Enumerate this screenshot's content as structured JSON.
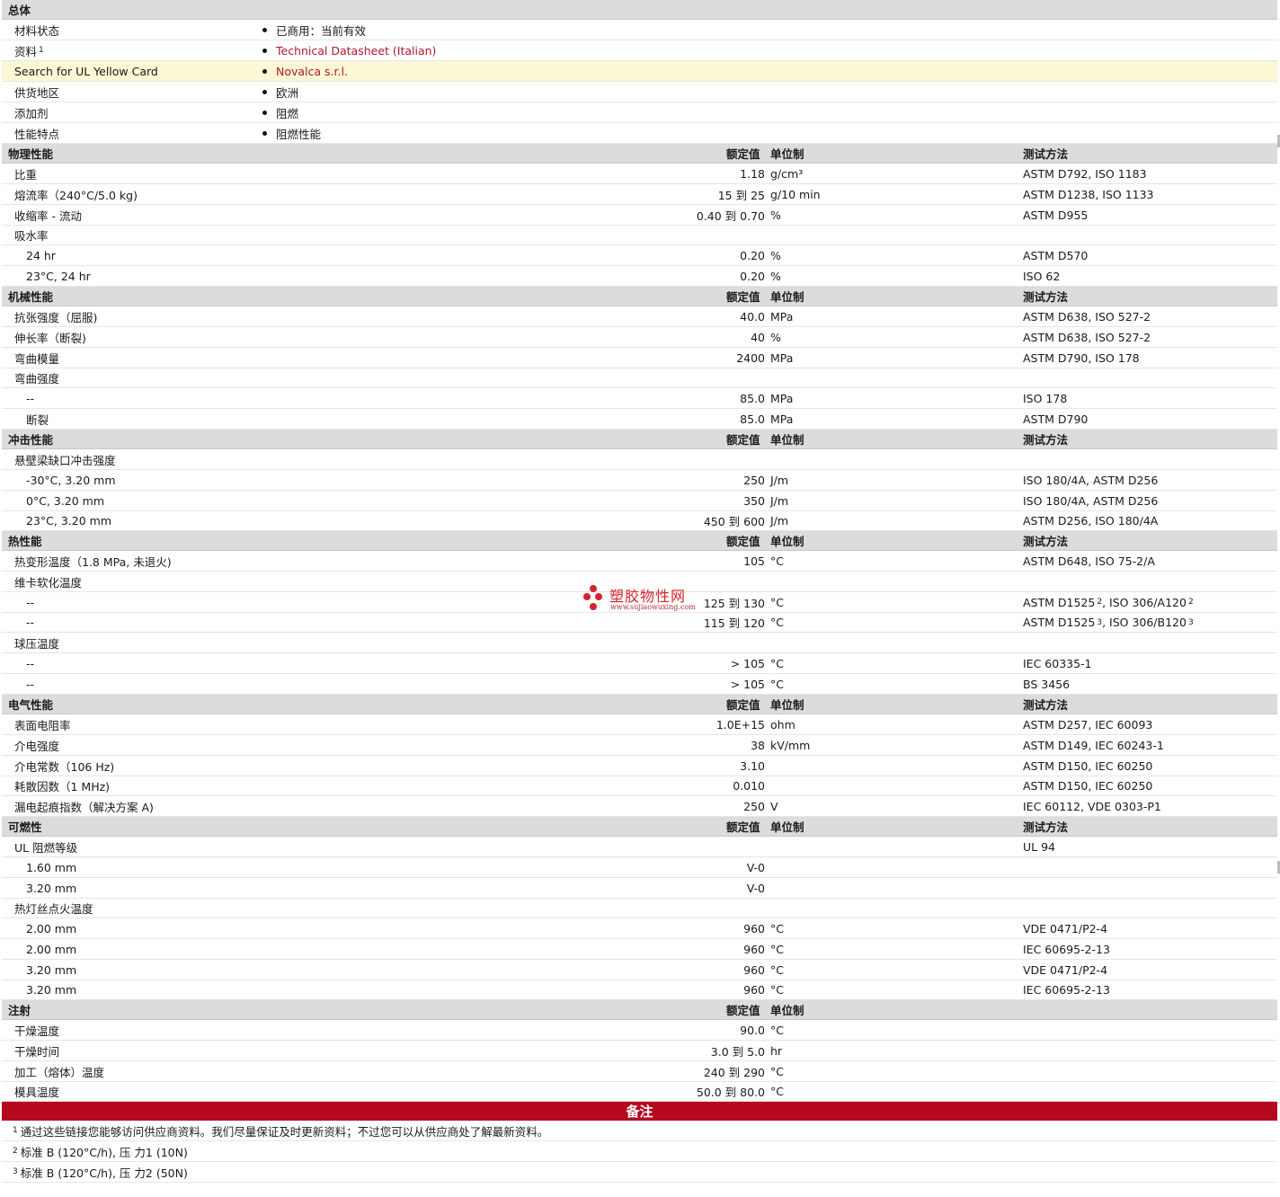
{
  "headers": {
    "value": "额定值",
    "unit": "单位制",
    "test": "测试方法"
  },
  "general": {
    "title": "总体",
    "rows": [
      {
        "label": "材料状态",
        "value": "已商用：当前有效",
        "link": false
      },
      {
        "label": "资料",
        "sup": "1",
        "value": "Technical Datasheet (Italian)",
        "link": true
      },
      {
        "label": "Search for UL Yellow Card",
        "value": "Novalca s.r.l.",
        "link": true,
        "highlight": true
      },
      {
        "label": "供货地区",
        "value": "欧洲",
        "link": false
      },
      {
        "label": "添加剂",
        "value": "阻燃",
        "link": false
      },
      {
        "label": "性能特点",
        "value": "阻燃性能",
        "link": false
      }
    ]
  },
  "sections": [
    {
      "title": "物理性能",
      "show_test": true,
      "rows": [
        {
          "label": "比重",
          "value": "1.18",
          "unit": "g/cm³",
          "test": "ASTM D792, ISO 1183"
        },
        {
          "label": "熔流率（240°C/5.0 kg)",
          "value": "15 到  25",
          "unit": "g/10 min",
          "test": "ASTM D1238, ISO 1133"
        },
        {
          "label": "收缩率 - 流动",
          "value": "0.40 到  0.70",
          "unit": "%",
          "test": "ASTM D955"
        },
        {
          "label": "吸水率"
        },
        {
          "label": "24 hr",
          "indent": true,
          "value": "0.20",
          "unit": "%",
          "test": "ASTM D570"
        },
        {
          "label": "23°C, 24 hr",
          "indent": true,
          "value": "0.20",
          "unit": "%",
          "test": "ISO 62"
        }
      ]
    },
    {
      "title": "机械性能",
      "show_test": true,
      "rows": [
        {
          "label": "抗张强度（屈服)",
          "value": "40.0",
          "unit": "MPa",
          "test": "ASTM D638, ISO 527-2"
        },
        {
          "label": "伸长率（断裂)",
          "value": "40",
          "unit": "%",
          "test": "ASTM D638, ISO 527-2"
        },
        {
          "label": "弯曲模量",
          "value": "2400",
          "unit": "MPa",
          "test": "ASTM D790, ISO 178"
        },
        {
          "label": "弯曲强度"
        },
        {
          "label": "--",
          "indent": true,
          "value": "85.0",
          "unit": "MPa",
          "test": "ISO 178"
        },
        {
          "label": "断裂",
          "indent": true,
          "value": "85.0",
          "unit": "MPa",
          "test": "ASTM D790"
        }
      ]
    },
    {
      "title": "冲击性能",
      "show_test": true,
      "rows": [
        {
          "label": "悬壁梁缺口冲击强度"
        },
        {
          "label": "-30°C, 3.20 mm",
          "indent": true,
          "value": "250",
          "unit": "J/m",
          "test": "ISO 180/4A, ASTM D256"
        },
        {
          "label": "0°C, 3.20 mm",
          "indent": true,
          "value": "350",
          "unit": "J/m",
          "test": "ISO 180/4A, ASTM D256"
        },
        {
          "label": "23°C, 3.20 mm",
          "indent": true,
          "value": "450 到  600",
          "unit": "J/m",
          "test": "ASTM D256, ISO 180/4A"
        }
      ]
    },
    {
      "title": "热性能",
      "show_test": true,
      "rows": [
        {
          "label": "热变形温度（1.8 MPa, 未退火)",
          "value": "105",
          "unit": "°C",
          "test": "ASTM D648, ISO 75-2/A"
        },
        {
          "label": "维卡软化温度"
        },
        {
          "label": "--",
          "indent": true,
          "value": "125 到  130",
          "unit": "°C",
          "test": "ASTM D1525",
          "test_sup": "2",
          "test2": ", ISO 306/A120",
          "test2_sup": "2"
        },
        {
          "label": "--",
          "indent": true,
          "value": "115 到  120",
          "unit": "°C",
          "test": "ASTM D1525",
          "test_sup": "3",
          "test2": ", ISO 306/B120",
          "test2_sup": "3"
        },
        {
          "label": "球压温度"
        },
        {
          "label": "--",
          "indent": true,
          "value": "> 105",
          "unit": "°C",
          "test": "IEC 60335-1"
        },
        {
          "label": "--",
          "indent": true,
          "value": "> 105",
          "unit": "°C",
          "test": "BS 3456"
        }
      ]
    },
    {
      "title": "电气性能",
      "show_test": true,
      "rows": [
        {
          "label": "表面电阻率",
          "value": "1.0E+15",
          "unit": "ohm",
          "test": "ASTM D257, IEC 60093"
        },
        {
          "label": "介电强度",
          "value": "38",
          "unit": "kV/mm",
          "test": "ASTM D149, IEC 60243-1"
        },
        {
          "label": "介电常数（106 Hz)",
          "value": "3.10",
          "unit": "",
          "test": "ASTM D150, IEC 60250"
        },
        {
          "label": "耗散因数（1 MHz)",
          "value": "0.010",
          "unit": "",
          "test": "ASTM D150, IEC 60250"
        },
        {
          "label": "漏电起痕指数（解决方案 A)",
          "value": "250",
          "unit": "V",
          "test": "IEC 60112, VDE 0303-P1"
        }
      ]
    },
    {
      "title": "可燃性",
      "show_test": true,
      "rows": [
        {
          "label": "UL 阻燃等级",
          "test": "UL 94"
        },
        {
          "label": "1.60 mm",
          "indent": true,
          "value": "V-0"
        },
        {
          "label": "3.20 mm",
          "indent": true,
          "value": "V-0"
        },
        {
          "label": "热灯丝点火温度"
        },
        {
          "label": "2.00 mm",
          "indent": true,
          "value": "960",
          "unit": "°C",
          "test": "VDE 0471/P2-4"
        },
        {
          "label": "2.00 mm",
          "indent": true,
          "value": "960",
          "unit": "°C",
          "test": "IEC 60695-2-13"
        },
        {
          "label": "3.20 mm",
          "indent": true,
          "value": "960",
          "unit": "°C",
          "test": "VDE 0471/P2-4"
        },
        {
          "label": "3.20 mm",
          "indent": true,
          "value": "960",
          "unit": "°C",
          "test": "IEC 60695-2-13"
        }
      ]
    },
    {
      "title": "注射",
      "show_test": false,
      "rows": [
        {
          "label": "干燥温度",
          "value": "90.0",
          "unit": "°C"
        },
        {
          "label": "干燥时间",
          "value": "3.0 到  5.0",
          "unit": "hr"
        },
        {
          "label": "加工（熔体）温度",
          "value": "240 到  290",
          "unit": "°C"
        },
        {
          "label": "模具温度",
          "value": "50.0 到  80.0",
          "unit": "°C"
        }
      ]
    }
  ],
  "notes": {
    "title": "备注",
    "items": [
      {
        "sup": "1",
        "text": "通过这些链接您能够访问供应商资料。我们尽量保证及时更新资料；不过您可以从供应商处了解最新资料。"
      },
      {
        "sup": "2",
        "text": "标准 B (120°C/h), 压  力1 (10N)"
      },
      {
        "sup": "3",
        "text": "标准 B (120°C/h), 压  力2 (50N)"
      }
    ]
  },
  "watermark": {
    "name": "塑胶物性网",
    "url": "www.sujiaowuxing.com",
    "color": "#d6232a"
  }
}
